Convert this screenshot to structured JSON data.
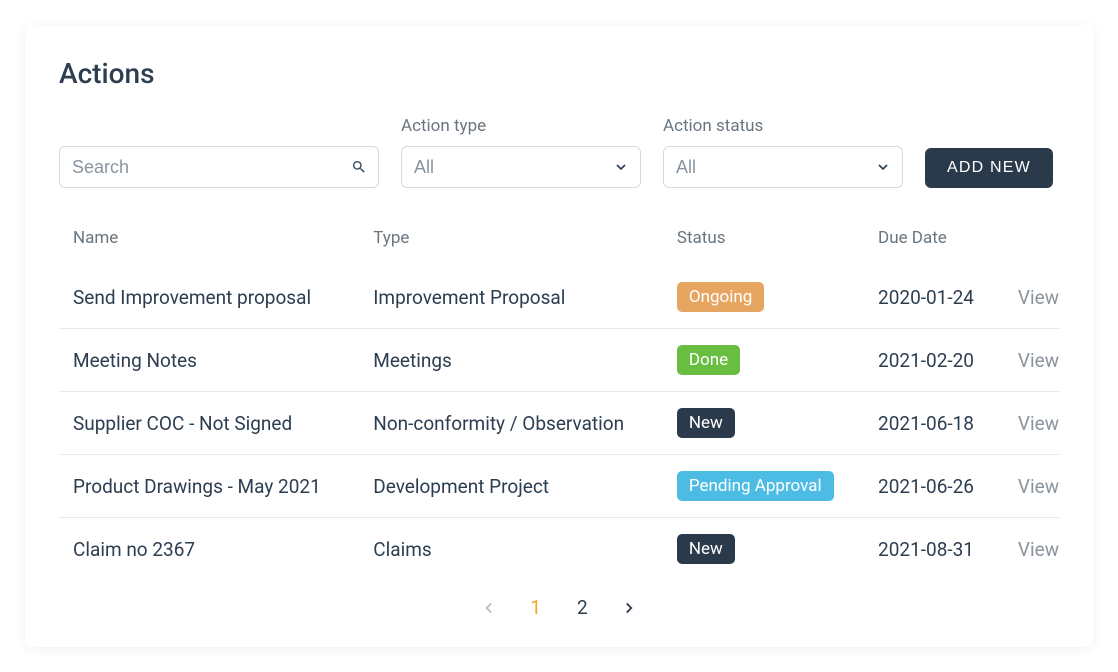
{
  "title": "Actions",
  "search": {
    "placeholder": "Search"
  },
  "filters": {
    "type": {
      "label": "Action type",
      "value": "All"
    },
    "status": {
      "label": "Action status",
      "value": "All"
    }
  },
  "addButton": "ADD NEW",
  "table": {
    "headers": {
      "name": "Name",
      "type": "Type",
      "status": "Status",
      "due": "Due Date"
    },
    "viewLabel": "View",
    "rows": [
      {
        "name": "Send Improvement proposal",
        "type": "Improvement Proposal",
        "status": {
          "label": "Ongoing",
          "variant": "ongoing"
        },
        "due": "2020-01-24"
      },
      {
        "name": "Meeting Notes",
        "type": "Meetings",
        "status": {
          "label": "Done",
          "variant": "done"
        },
        "due": "2021-02-20"
      },
      {
        "name": "Supplier COC - Not Signed",
        "type": "Non-conformity / Observation",
        "status": {
          "label": "New",
          "variant": "new"
        },
        "due": "2021-06-18"
      },
      {
        "name": "Product Drawings - May 2021",
        "type": "Development Project",
        "status": {
          "label": "Pending Approval",
          "variant": "pending"
        },
        "due": "2021-06-26"
      },
      {
        "name": "Claim no 2367",
        "type": "Claims",
        "status": {
          "label": "New",
          "variant": "new"
        },
        "due": "2021-08-31"
      }
    ]
  },
  "pagination": {
    "pages": [
      "1",
      "2"
    ],
    "active": "1"
  }
}
